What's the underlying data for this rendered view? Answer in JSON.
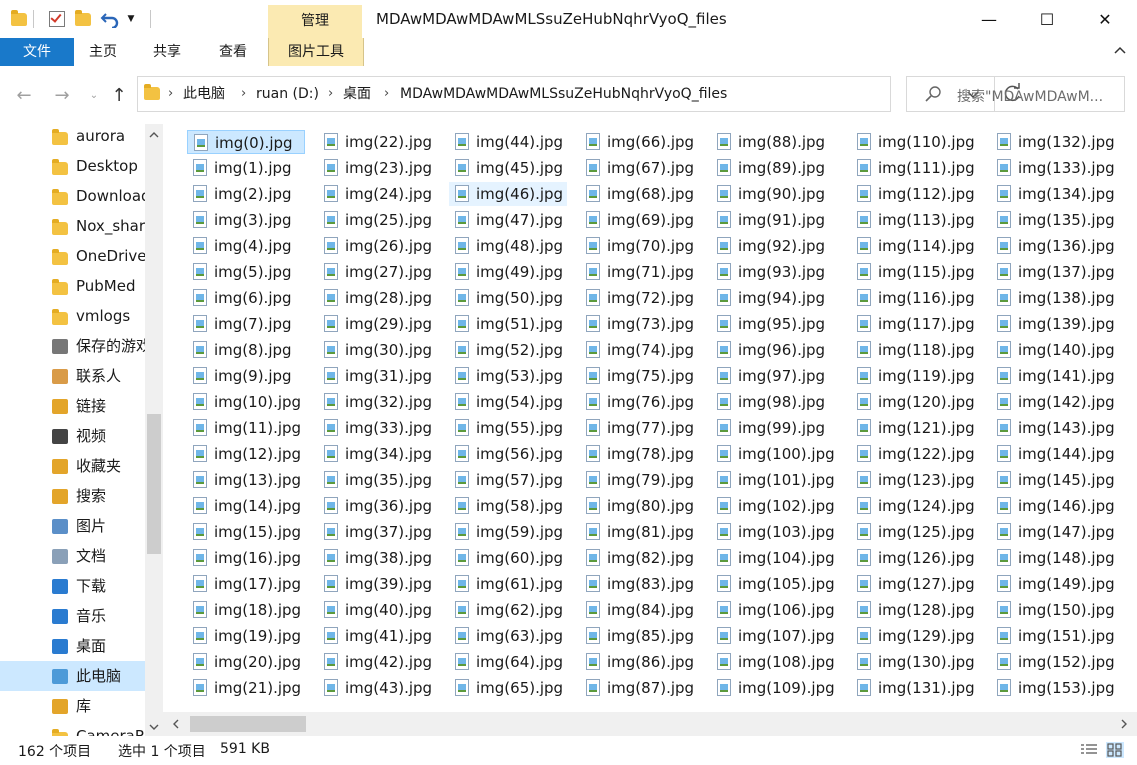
{
  "titlebar": {
    "context_tab_header": "管理",
    "window_title": "MDAwMDAwMDAwMLSsuZeHubNqhrVyoQ_files",
    "min_glyph": "—",
    "max_glyph": "☐",
    "close_glyph": "✕"
  },
  "ribbon": {
    "tabs": [
      "文件",
      "主页",
      "共享",
      "查看",
      "图片工具"
    ]
  },
  "address": {
    "crumbs": [
      "此电脑",
      "ruan (D:)",
      "桌面",
      "MDAwMDAwMDAwMLSsuZeHubNqhrVyoQ_files"
    ]
  },
  "search": {
    "placeholder": "搜索\"MDAwMDAwM..."
  },
  "sidebar": {
    "items": [
      {
        "label": "aurora",
        "icon": "folder-icon"
      },
      {
        "label": "Desktop",
        "icon": "folder-icon"
      },
      {
        "label": "Download",
        "icon": "folder-icon"
      },
      {
        "label": "Nox_shar",
        "icon": "folder-icon"
      },
      {
        "label": "OneDrive",
        "icon": "folder-icon"
      },
      {
        "label": "PubMed",
        "icon": "folder-icon"
      },
      {
        "label": "vmlogs",
        "icon": "folder-icon"
      },
      {
        "label": "保存的游戏",
        "icon": "saved-games-icon"
      },
      {
        "label": "联系人",
        "icon": "contacts-icon"
      },
      {
        "label": "链接",
        "icon": "links-icon"
      },
      {
        "label": "视频",
        "icon": "video-icon"
      },
      {
        "label": "收藏夹",
        "icon": "favorites-icon"
      },
      {
        "label": "搜索",
        "icon": "search-folder-icon"
      },
      {
        "label": "图片",
        "icon": "pictures-icon"
      },
      {
        "label": "文档",
        "icon": "documents-icon"
      },
      {
        "label": "下载",
        "icon": "download-icon"
      },
      {
        "label": "音乐",
        "icon": "music-icon"
      },
      {
        "label": "桌面",
        "icon": "desktop-icon"
      },
      {
        "label": "此电脑",
        "icon": "this-pc-icon"
      },
      {
        "label": "库",
        "icon": "library-icon"
      },
      {
        "label": "CameraR",
        "icon": "folder-icon"
      }
    ],
    "selected_label": "此电脑"
  },
  "files": {
    "prefix": "img(",
    "suffix": ").jpg",
    "count_shown": 154,
    "selected": "img(0).jpg",
    "hovered": "img(46).jpg"
  },
  "status": {
    "item_count": "162 个项目",
    "selection": "选中 1 个项目",
    "size": "591 KB"
  },
  "colors": {
    "accent": "#1979ca",
    "context_tab": "#fbeab2",
    "selection": "#cce8ff"
  }
}
